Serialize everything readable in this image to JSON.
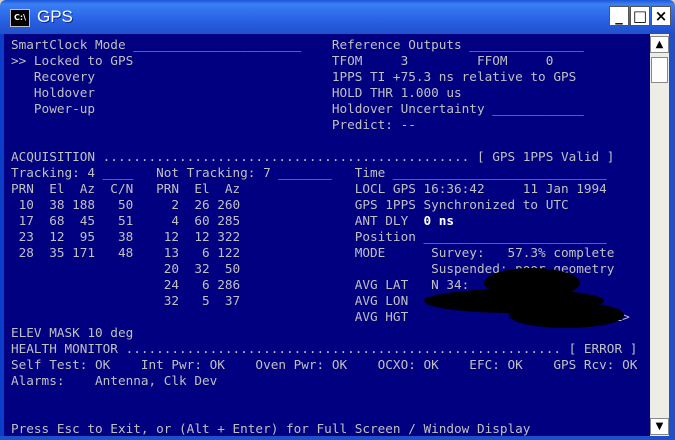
{
  "window": {
    "title": "GPS",
    "icon_label": "C:\\",
    "minimize": "_",
    "maximize": "□",
    "close": "×"
  },
  "scrollbar": {
    "up": "▲",
    "down": "▼"
  },
  "console": {
    "lines": [
      "SmartClock Mode ______________________    Reference Outputs _______________",
      ">> Locked to GPS                          TFOM     3         FFOM     0",
      "   Recovery                               1PPS TI +75.3 ns relative to GPS",
      "   Holdover                               HOLD THR 1.000 us",
      "   Power-up                               Holdover Uncertainty ____________",
      "                                          Predict: --",
      "",
      "ACQUISITION ................................................ [ GPS 1PPS Valid ]",
      "Tracking: 4 ____   Not Tracking: 7 _______   Time ____________________________",
      "PRN  El  Az  C/N   PRN  El  Az               LOCL GPS 16:36:42     11 Jan 1994",
      " 10  38 188   50     2  26 260               GPS 1PPS Synchronized to UTC",
      " 17  68  45   51     4  60 285               ANT DLY  ",
      " 23  12  95   38    12  12 322               Position ________________________",
      " 28  35 171   48    13   6 122               MODE      Survey:   57.3% complete",
      "                    20  32  50                         Suspended: poor geometry",
      "                    24   6 286               AVG LAT   N 34:",
      "                    32   5  37               AVG LON",
      "                                             AVG HGT                           L>",
      "ELEV MASK 10 deg",
      "HEALTH MONITOR ......................................................... [ ERROR ]",
      "Self Test: OK    Int Pwr: OK    Oven Pwr: OK    OCXO: OK    EFC: OK    GPS Rcv: OK",
      "Alarms:    Antenna, Clk Dev",
      "",
      "",
      "Press Esc to Exit, or (Alt + Enter) for Full Screen / Window Display"
    ],
    "ant_dly_value": "0 ns"
  }
}
